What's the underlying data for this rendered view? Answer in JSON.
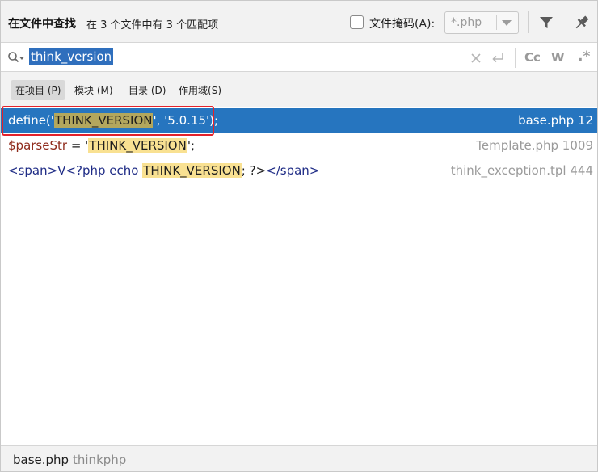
{
  "header": {
    "title": "在文件中查找",
    "subtitle": "在 3 个文件中有 3 个匹配项",
    "file_mask_label": "文件掩码(A):",
    "file_mask_value": "*.php",
    "file_mask_checked": false
  },
  "search": {
    "query": "think_version",
    "options": {
      "case": "Cc",
      "words": "W",
      "regex": ".*"
    }
  },
  "scopes": [
    {
      "label": "在项目",
      "mnemonic": "P",
      "active": true
    },
    {
      "label": "模块",
      "mnemonic": "M",
      "active": false
    },
    {
      "label": "目录",
      "mnemonic": "D",
      "active": false
    },
    {
      "label": "作用域",
      "mnemonic": "S",
      "active": false
    }
  ],
  "results": [
    {
      "pre": "define('",
      "match": "THINK_VERSION",
      "post": "', '5.0.15');",
      "location": "base.php 12",
      "selected": true
    },
    {
      "pre_var": "$parseStr",
      "pre": " = '",
      "match": "THINK_VERSION",
      "post": "';",
      "location": "Template.php 1009",
      "selected": false
    },
    {
      "pre_a": "<span>V<?",
      "pre_kw": "php echo",
      "pre_b": " ",
      "match": "THINK_VERSION",
      "post_a": "; ?>",
      "post_kw": "</span>",
      "location": "think_exception.tpl 444",
      "selected": false
    }
  ],
  "footer": {
    "file": "base.php",
    "directory": "thinkphp"
  },
  "colors": {
    "selection": "#2675bf",
    "match_highlight": "#f9e192",
    "annotation_box": "#e3222b"
  }
}
